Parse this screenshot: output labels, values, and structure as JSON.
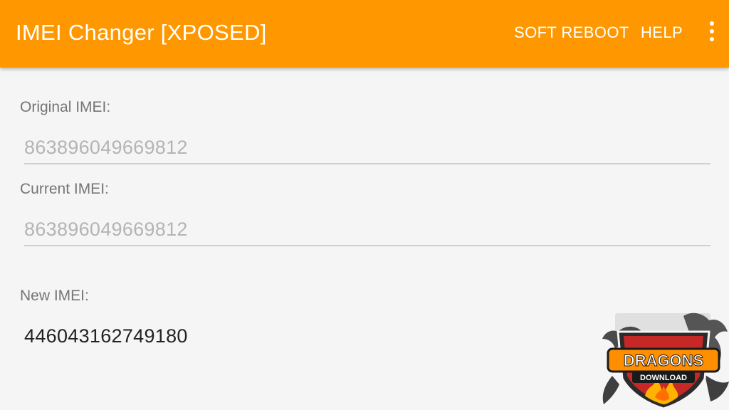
{
  "app_bar": {
    "title": "IMEI Changer [XPOSED]",
    "actions": [
      "SOFT REBOOT",
      "HELP"
    ],
    "overflow_icon": "more-vert-icon",
    "color": "#ff9800"
  },
  "fields": {
    "original": {
      "label": "Original IMEI:",
      "value": "863896049669812"
    },
    "current": {
      "label": "Current IMEI:",
      "value": "863896049669812"
    },
    "new": {
      "label": "New IMEI:",
      "value": "446043162749180"
    }
  },
  "watermark": {
    "text_top": "DRAGONS",
    "text_bottom": "DOWNLOAD"
  }
}
